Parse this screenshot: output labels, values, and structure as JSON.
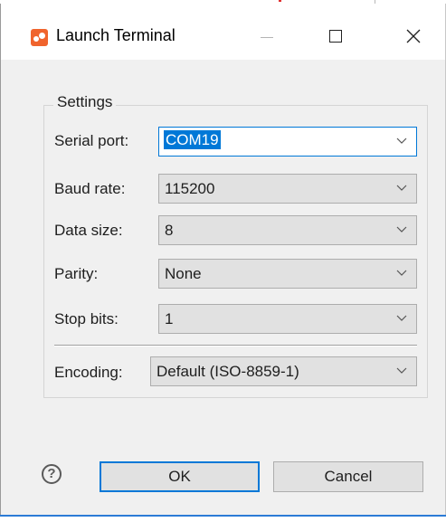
{
  "window": {
    "title": "Launch Terminal"
  },
  "settings": {
    "group_label": "Settings",
    "fields": [
      {
        "label": "Serial port:",
        "value": "COM19"
      },
      {
        "label": "Baud rate:",
        "value": "115200"
      },
      {
        "label": "Data size:",
        "value": "8"
      },
      {
        "label": "Parity:",
        "value": "None"
      },
      {
        "label": "Stop bits:",
        "value": "1"
      }
    ],
    "encoding": {
      "label": "Encoding:",
      "value": "Default (ISO-8859-1)"
    }
  },
  "buttons": {
    "help_glyph": "?",
    "ok": "OK",
    "cancel": "Cancel"
  },
  "colors": {
    "accent": "#0078d7",
    "app_icon": "#f0642d",
    "dialog_bg": "#f0f0f0"
  }
}
